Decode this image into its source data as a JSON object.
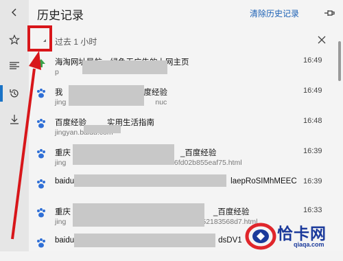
{
  "rail": {
    "icons": [
      "chevron-left-icon",
      "star-icon",
      "reading-list-icon",
      "history-icon",
      "download-icon"
    ]
  },
  "header": {
    "title": "历史记录",
    "clear_label": "清除历史记录"
  },
  "section": {
    "label": "过去 1 小时"
  },
  "entries": [
    {
      "title": "海淘网址导航，绿色无广告的上网主页",
      "url": "p",
      "time": "16:49",
      "icon": "green-arrow-icon"
    },
    {
      "title": "我",
      "url": "jing",
      "url_suffix": "nuc",
      "title_suffix": "度经验",
      "time": "16:49",
      "icon": "paw-icon"
    },
    {
      "title": "百度经验",
      "title_suffix": "实用生活指南",
      "url": "jingyan.baidu.com",
      "time": "16:48",
      "icon": "paw-icon"
    },
    {
      "title": "重庆",
      "title_suffix": "_百度经验",
      "url": "jing",
      "url_suffix": "8656fd02b855eaf75.html",
      "time": "16:39",
      "icon": "paw-icon"
    },
    {
      "title": "baidu",
      "title_suffix": "laepRoSIMhMEEC",
      "url": "",
      "time": "16:39",
      "icon": "paw-icon"
    },
    {
      "title": "重庆",
      "title_suffix": "_百度经验",
      "url": "jing",
      "url_suffix": "52183568d7.html",
      "time": "16:33",
      "icon": "paw-icon"
    },
    {
      "title": "baidu",
      "title_suffix": "dsDV1",
      "url": "",
      "time": "",
      "icon": "paw-icon"
    }
  ],
  "watermark": {
    "brand": "恰卡网",
    "domain": "qiaqa.com"
  },
  "colors": {
    "accent": "#1a5fb4",
    "annotation": "#d8161a",
    "watermark": "#1b3a9b"
  }
}
